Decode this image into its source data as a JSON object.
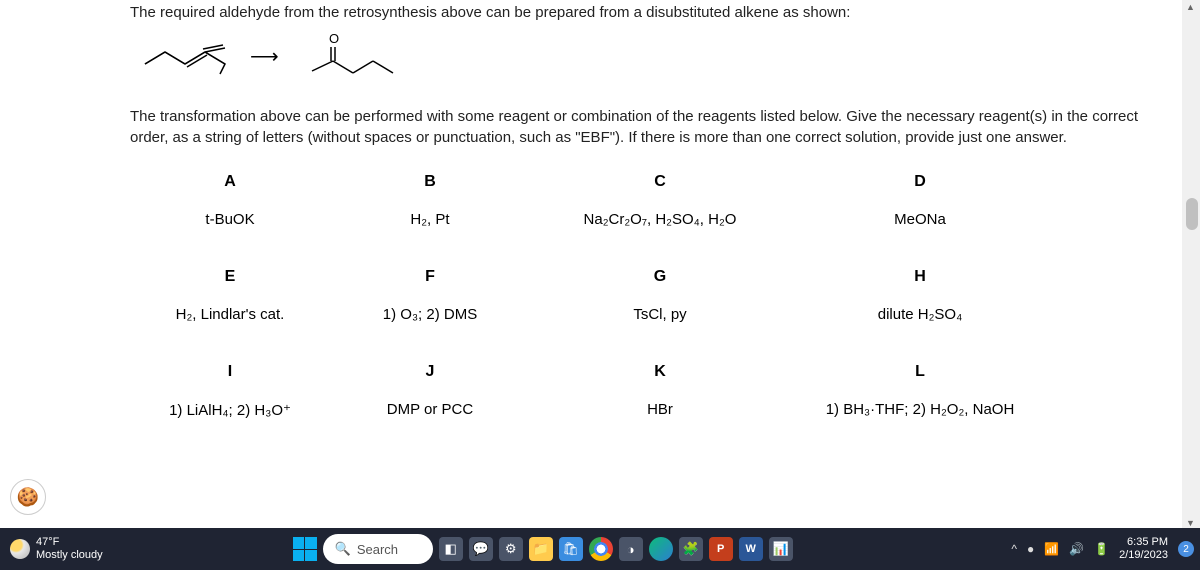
{
  "intro": "The required aldehyde from the retrosynthesis above can be prepared from a disubstituted alkene as shown:",
  "arrow": "⟶",
  "instruction": "The transformation above can be performed with some reagent or combination of the reagents listed below. Give the necessary reagent(s) in the correct order, as a string of letters (without spaces or punctuation, such as \"EBF\"). If there is more than one correct solution, provide just one answer.",
  "reagents": {
    "A": "t-BuOK",
    "B": "H₂, Pt",
    "C": "Na₂Cr₂O₇, H₂SO₄, H₂O",
    "D": "MeONa",
    "E": "H₂, Lindlar's cat.",
    "F": "1) O₃; 2) DMS",
    "G": "TsCl, py",
    "H": "dilute H₂SO₄",
    "I": "1) LiAlH₄; 2) H₃O⁺",
    "J": "DMP or PCC",
    "K": "HBr",
    "L": "1) BH₃·THF; 2) H₂O₂, NaOH"
  },
  "letters": [
    "A",
    "B",
    "C",
    "D",
    "E",
    "F",
    "G",
    "H",
    "I",
    "J",
    "K",
    "L"
  ],
  "weather": {
    "temp": "47°F",
    "cond": "Mostly cloudy"
  },
  "search_label": "Search",
  "datetime": {
    "time": "6:35 PM",
    "date": "2/19/2023"
  },
  "notif_count": "2"
}
